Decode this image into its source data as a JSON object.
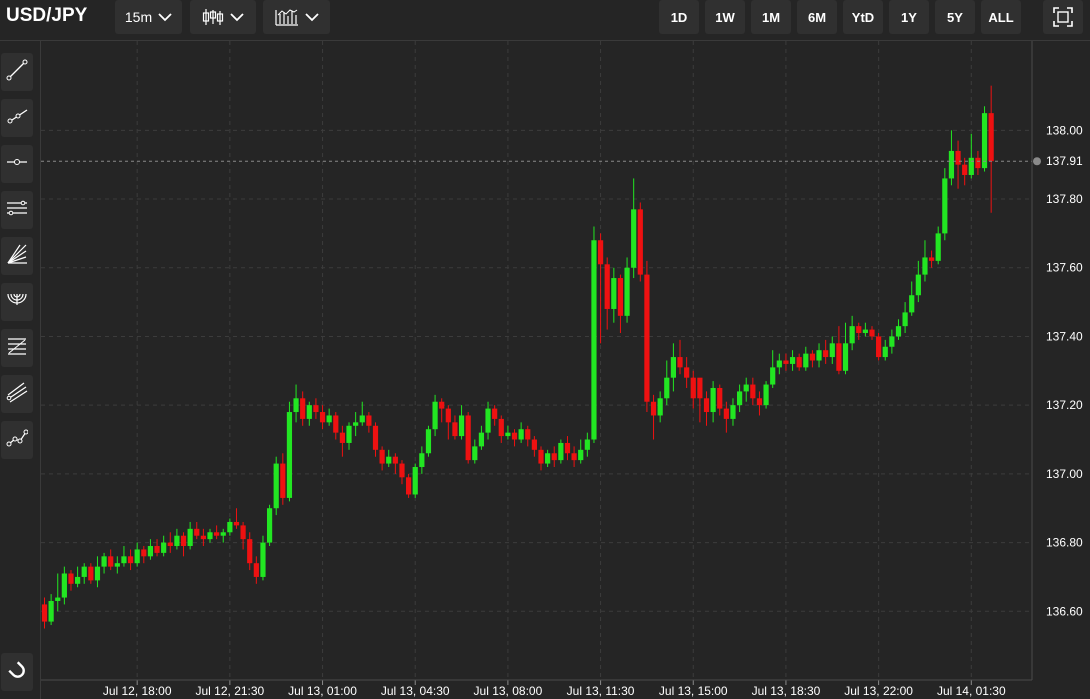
{
  "header": {
    "symbol": "USD/JPY",
    "interval": "15m",
    "chart_type_icon": "candlestick-icon",
    "indicators_icon": "indicators-icon",
    "ranges": [
      "1D",
      "1W",
      "1M",
      "6M",
      "YtD",
      "1Y",
      "5Y",
      "ALL"
    ],
    "fullscreen_icon": "fullscreen-icon"
  },
  "toolbar": {
    "tools": [
      "trend-line-icon",
      "ray-icon",
      "horizontal-line-icon",
      "parallel-channel-icon",
      "fan-icon",
      "arc-icon",
      "fib-retracement-icon",
      "pitchfork-icon",
      "path-icon"
    ],
    "magnet_icon": "magnet-icon"
  },
  "colors": {
    "background": "#252525",
    "grid": "#3c3c3c",
    "up": "#22e622",
    "down": "#ee1111",
    "price_line": "#8a8a8a"
  },
  "chart_data": {
    "type": "candlestick",
    "symbol": "USD/JPY",
    "interval": "15m",
    "current_price": "137.91",
    "y_ticks": [
      "138.00",
      "137.80",
      "137.60",
      "137.40",
      "137.20",
      "137.00",
      "136.80",
      "136.60"
    ],
    "x_ticks": [
      "Jul 12, 18:00",
      "Jul 12, 21:30",
      "Jul 13, 01:00",
      "Jul 13, 04:30",
      "Jul 13, 08:00",
      "Jul 13, 11:30",
      "Jul 13, 15:00",
      "Jul 13, 18:30",
      "Jul 13, 22:00",
      "Jul 14, 01:30"
    ],
    "ylim": [
      136.4,
      138.26
    ],
    "grid": true,
    "x_start": "Jul 12, 14:30",
    "candle_minutes": 15,
    "candles": [
      [
        136.62,
        136.57,
        136.64,
        136.55
      ],
      [
        136.57,
        136.63,
        136.65,
        136.56
      ],
      [
        136.63,
        136.64,
        136.71,
        136.6
      ],
      [
        136.64,
        136.71,
        136.73,
        136.62
      ],
      [
        136.71,
        136.68,
        136.72,
        136.66
      ],
      [
        136.68,
        136.7,
        136.73,
        136.67
      ],
      [
        136.7,
        136.73,
        136.74,
        136.68
      ],
      [
        136.73,
        136.69,
        136.74,
        136.68
      ],
      [
        136.69,
        136.73,
        136.76,
        136.67
      ],
      [
        136.73,
        136.76,
        136.77,
        136.71
      ],
      [
        136.76,
        136.73,
        136.78,
        136.72
      ],
      [
        136.73,
        136.74,
        136.76,
        136.71
      ],
      [
        136.74,
        136.76,
        136.79,
        136.73
      ],
      [
        136.76,
        136.74,
        136.78,
        136.72
      ],
      [
        136.74,
        136.78,
        136.8,
        136.73
      ],
      [
        136.78,
        136.76,
        136.79,
        136.74
      ],
      [
        136.76,
        136.79,
        136.81,
        136.75
      ],
      [
        136.79,
        136.77,
        136.81,
        136.76
      ],
      [
        136.77,
        136.8,
        136.82,
        136.76
      ],
      [
        136.8,
        136.79,
        136.83,
        136.77
      ],
      [
        136.79,
        136.82,
        136.84,
        136.78
      ],
      [
        136.82,
        136.79,
        136.83,
        136.76
      ],
      [
        136.79,
        136.84,
        136.86,
        136.78
      ],
      [
        136.84,
        136.82,
        136.86,
        136.81
      ],
      [
        136.82,
        136.81,
        136.84,
        136.79
      ],
      [
        136.81,
        136.83,
        136.84,
        136.8
      ],
      [
        136.83,
        136.82,
        136.85,
        136.81
      ],
      [
        136.82,
        136.83,
        136.84,
        136.8
      ],
      [
        136.83,
        136.86,
        136.87,
        136.82
      ],
      [
        136.86,
        136.85,
        136.9,
        136.84
      ],
      [
        136.85,
        136.81,
        136.86,
        136.78
      ],
      [
        136.81,
        136.74,
        136.83,
        136.72
      ],
      [
        136.74,
        136.7,
        136.76,
        136.68
      ],
      [
        136.7,
        136.8,
        136.82,
        136.69
      ],
      [
        136.8,
        136.9,
        136.91,
        136.79
      ],
      [
        136.9,
        137.03,
        137.05,
        136.88
      ],
      [
        137.03,
        136.93,
        137.06,
        136.91
      ],
      [
        136.93,
        137.18,
        137.21,
        136.92
      ],
      [
        137.18,
        137.22,
        137.26,
        137.15
      ],
      [
        137.22,
        137.16,
        137.24,
        137.14
      ],
      [
        137.16,
        137.2,
        137.21,
        137.14
      ],
      [
        137.2,
        137.18,
        137.22,
        137.16
      ],
      [
        137.18,
        137.15,
        137.2,
        137.13
      ],
      [
        137.15,
        137.17,
        137.19,
        137.14
      ],
      [
        137.17,
        137.12,
        137.18,
        137.1
      ],
      [
        137.12,
        137.09,
        137.14,
        137.05
      ],
      [
        137.09,
        137.14,
        137.15,
        137.07
      ],
      [
        137.14,
        137.15,
        137.18,
        137.11
      ],
      [
        137.15,
        137.17,
        137.21,
        137.14
      ],
      [
        137.17,
        137.14,
        137.18,
        137.12
      ],
      [
        137.14,
        137.07,
        137.15,
        137.05
      ],
      [
        137.07,
        137.03,
        137.08,
        137.01
      ],
      [
        137.03,
        137.05,
        137.07,
        137.02
      ],
      [
        137.05,
        137.03,
        137.06,
        137.0
      ],
      [
        137.03,
        136.99,
        137.04,
        136.97
      ],
      [
        136.99,
        136.94,
        137.0,
        136.93
      ],
      [
        136.94,
        137.02,
        137.03,
        136.93
      ],
      [
        137.02,
        137.06,
        137.08,
        137.0
      ],
      [
        137.06,
        137.13,
        137.14,
        137.05
      ],
      [
        137.13,
        137.21,
        137.23,
        137.11
      ],
      [
        137.21,
        137.19,
        137.22,
        137.15
      ],
      [
        137.19,
        137.15,
        137.2,
        137.1
      ],
      [
        137.15,
        137.11,
        137.17,
        137.1
      ],
      [
        137.11,
        137.17,
        137.2,
        137.1
      ],
      [
        137.17,
        137.04,
        137.18,
        137.03
      ],
      [
        137.04,
        137.08,
        137.1,
        137.03
      ],
      [
        137.08,
        137.12,
        137.14,
        137.07
      ],
      [
        137.12,
        137.19,
        137.21,
        137.1
      ],
      [
        137.19,
        137.16,
        137.2,
        137.14
      ],
      [
        137.16,
        137.11,
        137.17,
        137.09
      ],
      [
        137.11,
        137.12,
        137.14,
        137.1
      ],
      [
        137.12,
        137.1,
        137.13,
        137.08
      ],
      [
        137.1,
        137.13,
        137.15,
        137.09
      ],
      [
        137.13,
        137.1,
        137.14,
        137.08
      ],
      [
        137.1,
        137.07,
        137.11,
        137.05
      ],
      [
        137.07,
        137.03,
        137.08,
        137.01
      ],
      [
        137.03,
        137.06,
        137.07,
        137.02
      ],
      [
        137.06,
        137.04,
        137.08,
        137.02
      ],
      [
        137.04,
        137.09,
        137.1,
        137.03
      ],
      [
        137.09,
        137.06,
        137.11,
        137.04
      ],
      [
        137.06,
        137.04,
        137.08,
        137.02
      ],
      [
        137.04,
        137.07,
        137.1,
        137.03
      ],
      [
        137.07,
        137.1,
        137.12,
        137.05
      ],
      [
        137.1,
        137.68,
        137.72,
        137.09
      ],
      [
        137.68,
        137.61,
        137.7,
        137.38
      ],
      [
        137.61,
        137.48,
        137.63,
        137.42
      ],
      [
        137.48,
        137.57,
        137.6,
        137.44
      ],
      [
        137.57,
        137.46,
        137.58,
        137.41
      ],
      [
        137.46,
        137.6,
        137.63,
        137.44
      ],
      [
        137.6,
        137.77,
        137.86,
        137.57
      ],
      [
        137.77,
        137.58,
        137.79,
        137.56
      ],
      [
        137.58,
        137.21,
        137.62,
        137.18
      ],
      [
        137.21,
        137.17,
        137.23,
        137.1
      ],
      [
        137.17,
        137.22,
        137.24,
        137.15
      ],
      [
        137.22,
        137.28,
        137.33,
        137.2
      ],
      [
        137.28,
        137.34,
        137.38,
        137.24
      ],
      [
        137.34,
        137.31,
        137.39,
        137.29
      ],
      [
        137.31,
        137.28,
        137.34,
        137.25
      ],
      [
        137.28,
        137.22,
        137.3,
        137.19
      ],
      [
        137.28,
        137.22,
        137.27,
        137.15
      ],
      [
        137.22,
        137.18,
        137.24,
        137.14
      ],
      [
        137.18,
        137.25,
        137.27,
        137.15
      ],
      [
        137.25,
        137.19,
        137.26,
        137.17
      ],
      [
        137.19,
        137.16,
        137.21,
        137.12
      ],
      [
        137.16,
        137.2,
        137.22,
        137.14
      ],
      [
        137.2,
        137.24,
        137.26,
        137.18
      ],
      [
        137.24,
        137.26,
        137.28,
        137.21
      ],
      [
        137.26,
        137.22,
        137.28,
        137.2
      ],
      [
        137.22,
        137.2,
        137.24,
        137.17
      ],
      [
        137.2,
        137.26,
        137.27,
        137.19
      ],
      [
        137.26,
        137.31,
        137.36,
        137.25
      ],
      [
        137.31,
        137.33,
        137.35,
        137.29
      ],
      [
        137.33,
        137.32,
        137.35,
        137.3
      ],
      [
        137.32,
        137.34,
        137.36,
        137.3
      ],
      [
        137.34,
        137.31,
        137.35,
        137.3
      ],
      [
        137.31,
        137.35,
        137.37,
        137.3
      ],
      [
        137.35,
        137.33,
        137.36,
        137.31
      ],
      [
        137.33,
        137.36,
        137.38,
        137.31
      ],
      [
        137.36,
        137.34,
        137.39,
        137.32
      ],
      [
        137.34,
        137.38,
        137.4,
        137.32
      ],
      [
        137.38,
        137.3,
        137.43,
        137.29
      ],
      [
        137.3,
        137.38,
        137.44,
        137.29
      ],
      [
        137.38,
        137.43,
        137.46,
        137.36
      ],
      [
        137.43,
        137.41,
        137.44,
        137.39
      ],
      [
        137.41,
        137.42,
        137.44,
        137.4
      ],
      [
        137.42,
        137.4,
        137.43,
        137.39
      ],
      [
        137.4,
        137.34,
        137.41,
        137.33
      ],
      [
        137.34,
        137.37,
        137.39,
        137.33
      ],
      [
        137.37,
        137.4,
        137.42,
        137.35
      ],
      [
        137.4,
        137.43,
        137.45,
        137.39
      ],
      [
        137.43,
        137.47,
        137.5,
        137.41
      ],
      [
        137.47,
        137.52,
        137.56,
        137.46
      ],
      [
        137.52,
        137.58,
        137.62,
        137.5
      ],
      [
        137.58,
        137.63,
        137.68,
        137.56
      ],
      [
        137.63,
        137.62,
        137.65,
        137.6
      ],
      [
        137.62,
        137.7,
        137.72,
        137.61
      ],
      [
        137.7,
        137.86,
        137.89,
        137.68
      ],
      [
        137.86,
        137.94,
        138.0,
        137.84
      ],
      [
        137.94,
        137.9,
        137.97,
        137.83
      ],
      [
        137.9,
        137.87,
        137.92,
        137.84
      ],
      [
        137.87,
        137.92,
        137.99,
        137.86
      ],
      [
        137.92,
        137.89,
        137.94,
        137.87
      ],
      [
        137.89,
        138.05,
        138.07,
        137.88
      ],
      [
        138.05,
        137.91,
        138.13,
        137.76
      ]
    ]
  }
}
